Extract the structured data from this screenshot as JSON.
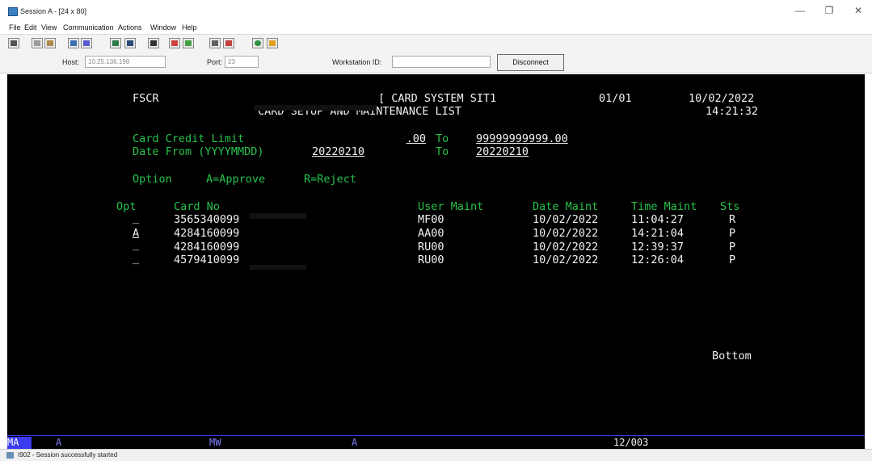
{
  "window": {
    "title": "Session A - [24 x 80]",
    "minimize": "—",
    "restore": "❐",
    "close": "✕"
  },
  "menu": [
    "File",
    "Edit",
    "View",
    "Communication",
    "Actions",
    "Window",
    "Help"
  ],
  "toolbar_icons": [
    "print-icon",
    "copy-icon",
    "paste-icon",
    "send-icon",
    "receive-icon",
    "display-icon",
    "display2-icon",
    "macro-icon",
    "color-icon",
    "color2-icon",
    "keyboard-icon",
    "keyboard2-icon",
    "globe-icon",
    "help-icon"
  ],
  "hostbar": {
    "host_label": "Host:",
    "host_value": "10.25.136.198",
    "port_label": "Port:",
    "port_value": "23",
    "workstation_label": "Workstation ID:",
    "workstation_value": "",
    "disconnect_label": "Disconnect"
  },
  "screen": {
    "screen_id": "FSCR",
    "title_line1": "[ CARD SYSTEM SIT1",
    "title_line2": "CARD SETUP AND MAINTENANCE LIST",
    "page": "01/01",
    "date": "10/02/2022",
    "time": "14:21:32",
    "credit_limit_label": "Card Credit Limit",
    "credit_limit_from": ".00",
    "to_label": "To",
    "credit_limit_to": "99999999999.00",
    "date_from_label": "Date From (YYYYMMDD)",
    "date_from": "20220210",
    "date_to": "20220210",
    "option_label": "Option",
    "option_approve": "A=Approve",
    "option_reject": "R=Reject",
    "columns": {
      "opt": "Opt",
      "card_no": "Card No",
      "user_maint": "User Maint",
      "date_maint": "Date Maint",
      "time_maint": "Time Maint",
      "sts": "Sts"
    },
    "rows": [
      {
        "opt": "_",
        "card_no": "3565340099",
        "user": "MF00",
        "date": "10/02/2022",
        "time": "11:04:27",
        "sts": "R"
      },
      {
        "opt": "A",
        "card_no": "4284160099",
        "user": "AA00",
        "date": "10/02/2022",
        "time": "14:21:04",
        "sts": "P"
      },
      {
        "opt": "_",
        "card_no": "4284160099",
        "user": "RU00",
        "date": "10/02/2022",
        "time": "12:39:37",
        "sts": "P"
      },
      {
        "opt": "_",
        "card_no": "4579410099",
        "user": "RU00",
        "date": "10/02/2022",
        "time": "12:26:04",
        "sts": "P"
      }
    ],
    "bottom_label": "Bottom"
  },
  "oia": {
    "ma": "MA",
    "a1": "A",
    "mw": "MW",
    "a2": "A",
    "cursor": "12/003"
  },
  "statusbar": {
    "message": "I902 - Session successfully started"
  }
}
